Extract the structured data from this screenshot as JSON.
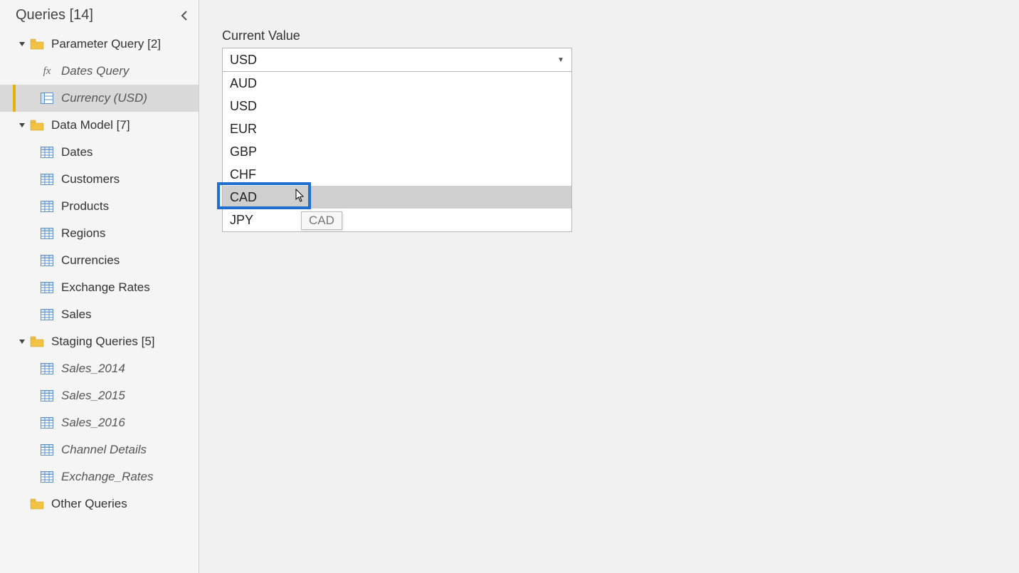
{
  "sidebar": {
    "title": "Queries [14]",
    "groups": [
      {
        "label": "Parameter Query [2]",
        "items": [
          {
            "label": "Dates Query",
            "icon": "fx",
            "italic": true,
            "selected": false
          },
          {
            "label": "Currency (USD)",
            "icon": "param",
            "italic": true,
            "selected": true
          }
        ]
      },
      {
        "label": "Data Model [7]",
        "items": [
          {
            "label": "Dates",
            "icon": "table",
            "italic": false
          },
          {
            "label": "Customers",
            "icon": "table",
            "italic": false
          },
          {
            "label": "Products",
            "icon": "table",
            "italic": false
          },
          {
            "label": "Regions",
            "icon": "table",
            "italic": false
          },
          {
            "label": "Currencies",
            "icon": "table",
            "italic": false
          },
          {
            "label": "Exchange Rates",
            "icon": "table",
            "italic": false
          },
          {
            "label": "Sales",
            "icon": "table",
            "italic": false
          }
        ]
      },
      {
        "label": "Staging Queries [5]",
        "items": [
          {
            "label": "Sales_2014",
            "icon": "table",
            "italic": true
          },
          {
            "label": "Sales_2015",
            "icon": "table",
            "italic": true
          },
          {
            "label": "Sales_2016",
            "icon": "table",
            "italic": true
          },
          {
            "label": "Channel Details",
            "icon": "table",
            "italic": true
          },
          {
            "label": "Exchange_Rates",
            "icon": "table",
            "italic": true
          }
        ]
      }
    ],
    "other_label": "Other Queries"
  },
  "main": {
    "field_label": "Current Value",
    "selected_value": "USD",
    "options": [
      "AUD",
      "USD",
      "EUR",
      "GBP",
      "CHF",
      "CAD",
      "JPY"
    ],
    "hover_index": 5,
    "tooltip_text": "CAD"
  },
  "colors": {
    "accent": "#e8b200",
    "highlight": "#1f6fd0"
  }
}
